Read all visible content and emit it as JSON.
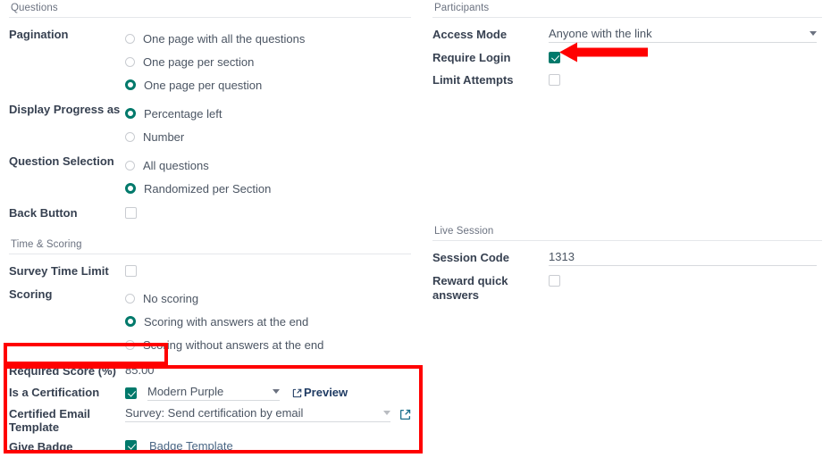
{
  "left": {
    "questions": {
      "title": "Questions",
      "pagination": {
        "label": "Pagination",
        "options": [
          {
            "label": "One page with all the questions",
            "selected": false
          },
          {
            "label": "One page per section",
            "selected": false
          },
          {
            "label": "One page per question",
            "selected": true
          }
        ]
      },
      "display_progress": {
        "label": "Display Progress as",
        "options": [
          {
            "label": "Percentage left",
            "selected": true
          },
          {
            "label": "Number",
            "selected": false
          }
        ]
      },
      "question_selection": {
        "label": "Question Selection",
        "options": [
          {
            "label": "All questions",
            "selected": false
          },
          {
            "label": "Randomized per Section",
            "selected": true
          }
        ]
      },
      "back_button": {
        "label": "Back Button",
        "checked": false
      }
    },
    "time_scoring": {
      "title": "Time & Scoring",
      "survey_time_limit": {
        "label": "Survey Time Limit",
        "checked": false
      },
      "scoring": {
        "label": "Scoring",
        "options": [
          {
            "label": "No scoring",
            "selected": false
          },
          {
            "label": "Scoring with answers at the end",
            "selected": true
          },
          {
            "label": "Scoring without answers at the end",
            "selected": false
          }
        ]
      },
      "required_score": {
        "label": "Required Score (%)",
        "value": "85.00"
      },
      "is_certification": {
        "label": "Is a Certification",
        "checked": true,
        "template_value": "Modern Purple",
        "preview_label": "Preview",
        "preview_icon": "external-link-icon"
      },
      "certified_email_template": {
        "label": "Certified Email Template",
        "value": "Survey: Send certification by email",
        "open_icon": "external-link-icon"
      },
      "give_badge": {
        "label": "Give Badge",
        "checked": true,
        "link_label": "Badge Template"
      }
    }
  },
  "right": {
    "participants": {
      "title": "Participants",
      "access_mode": {
        "label": "Access Mode",
        "value": "Anyone with the link"
      },
      "require_login": {
        "label": "Require Login",
        "checked": true
      },
      "limit_attempts": {
        "label": "Limit Attempts",
        "checked": false
      }
    },
    "live_session": {
      "title": "Live Session",
      "session_code": {
        "label": "Session Code",
        "value": "1313"
      },
      "reward_quick_answers": {
        "label": "Reward quick answers",
        "checked": false
      }
    }
  },
  "annotations": {
    "accent_color": "#ff0000",
    "highlight_required_score": true,
    "highlight_certification_block": true,
    "arrow_target": "require-login-checkbox"
  }
}
